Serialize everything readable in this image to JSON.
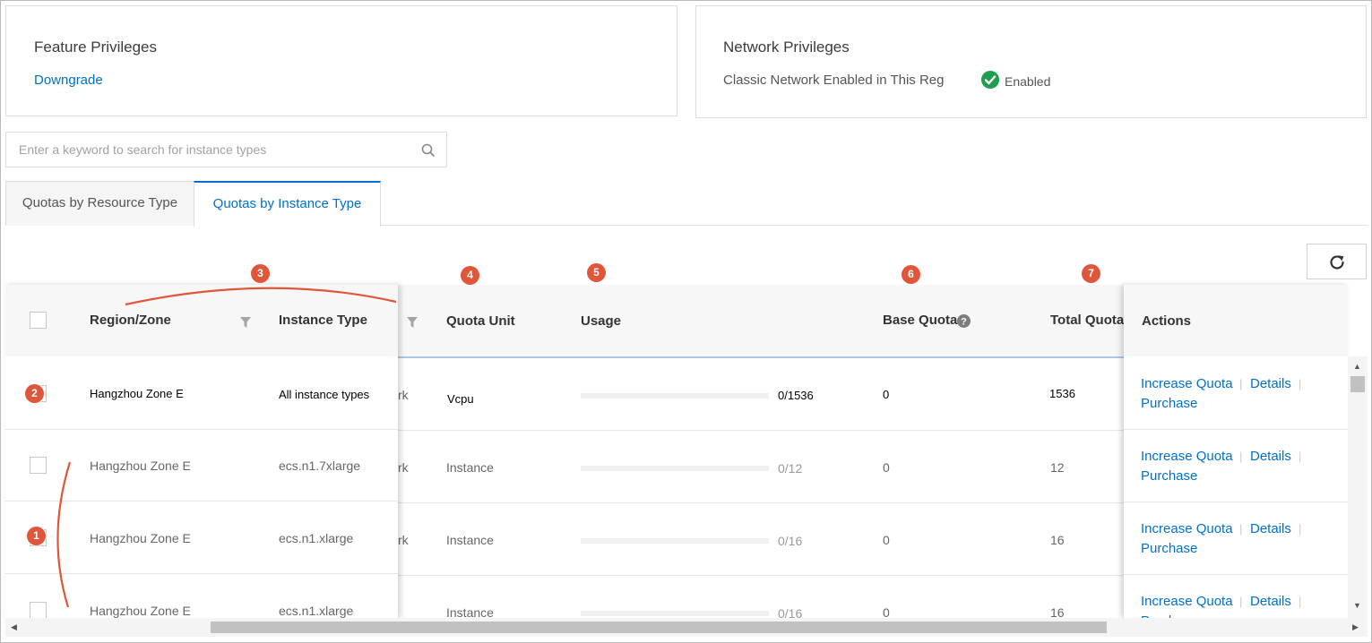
{
  "feature_panel": {
    "title": "Feature Privileges",
    "link": "Downgrade"
  },
  "network_panel": {
    "title": "Network Privileges",
    "label": "Classic Network Enabled in This Reg",
    "status": "Enabled",
    "status_color": "#1e9e4f"
  },
  "search": {
    "placeholder": "Enter a keyword to search for instance types",
    "icon": "search-icon"
  },
  "tabs": [
    {
      "label": "Quotas by Resource Type",
      "active": false
    },
    {
      "label": "Quotas by Instance Type",
      "active": true
    }
  ],
  "toolbar": {
    "refresh_icon": "refresh-icon"
  },
  "columns": {
    "region": "Region/Zone",
    "instance_type": "Instance Type",
    "hidden_partial": "rk",
    "quota_unit": "Quota Unit",
    "usage": "Usage",
    "base_quota": "Base Quota",
    "total_quota": "Total Quota",
    "actions": "Actions"
  },
  "rows": [
    {
      "region": "Hangzhou Zone E",
      "instance_type": "All instance types",
      "hidden": "rk",
      "unit": "Vcpu",
      "usage": "0/1536",
      "usage_fraction": 0,
      "base": "0",
      "total": "1536"
    },
    {
      "region": "Hangzhou Zone E",
      "instance_type": "ecs.n1.7xlarge",
      "hidden": "rk",
      "unit": "Instance",
      "usage": "0/12",
      "usage_fraction": 0,
      "base": "0",
      "total": "12"
    },
    {
      "region": "Hangzhou Zone E",
      "instance_type": "ecs.n1.xlarge",
      "hidden": "rk",
      "unit": "Instance",
      "usage": "0/16",
      "usage_fraction": 0,
      "base": "0",
      "total": "16"
    },
    {
      "region": "Hangzhou Zone E",
      "instance_type": "ecs.n1.xlarge",
      "hidden": "",
      "unit": "Instance",
      "usage": "0/16",
      "usage_fraction": 0,
      "base": "0",
      "total": "16"
    }
  ],
  "actions": {
    "increase": "Increase Quota",
    "details": "Details",
    "purchase": "Purchase",
    "separator": "|"
  },
  "annotations": [
    "1",
    "2",
    "3",
    "4",
    "5",
    "6",
    "7"
  ],
  "colors": {
    "accent": "#0070cc",
    "marker": "#e0563a",
    "header_bg": "#f7f7f7"
  }
}
